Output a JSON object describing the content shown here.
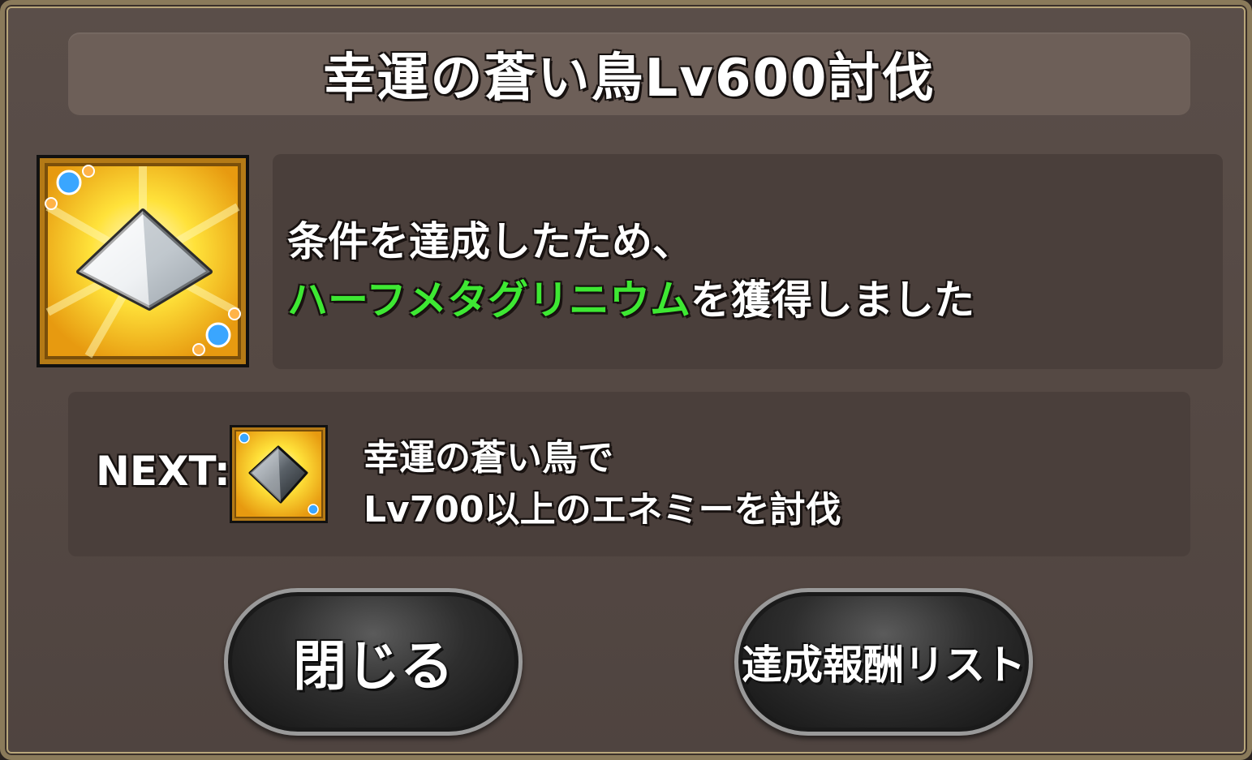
{
  "dialog": {
    "title": "幸運の蒼い鳥Lv600討伐",
    "message": {
      "line1": "条件を達成したため、",
      "item_name": "ハーフメタグリニウム",
      "line2_suffix": "を獲得しました",
      "item_name_color": "#3ee833"
    },
    "reward_icon": "half-metal-crystal-icon",
    "next": {
      "label": "NEXT:",
      "icon": "metal-crystal-icon",
      "line1": "幸運の蒼い鳥で",
      "line2": "Lv700以上のエネミーを討伐"
    },
    "buttons": {
      "close_label": "閉じる",
      "reward_list_label": "達成報酬リスト"
    }
  }
}
